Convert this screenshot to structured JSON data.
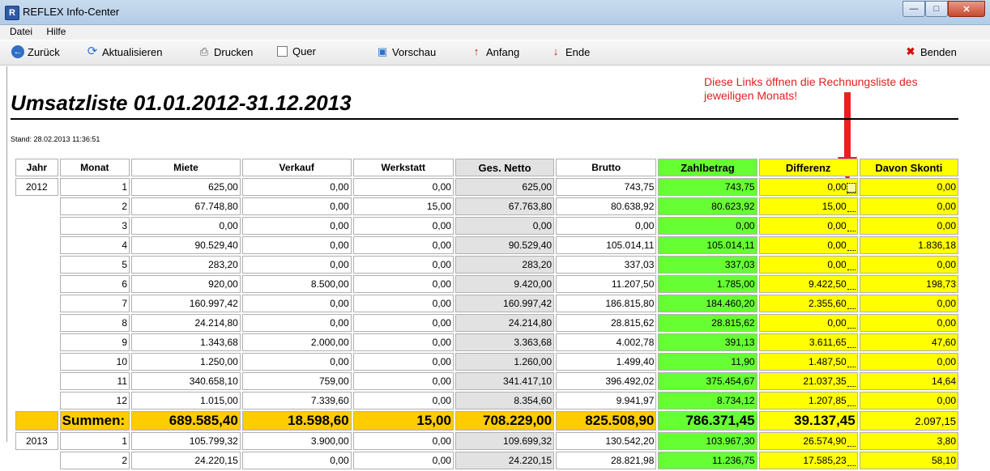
{
  "window": {
    "title": "REFLEX Info-Center"
  },
  "menu": [
    "Datei",
    "Hilfe"
  ],
  "toolbar": {
    "back": "Zurück",
    "refresh": "Aktualisieren",
    "print": "Drucken",
    "landscape": "Quer",
    "preview": "Vorschau",
    "start": "Anfang",
    "end": "Ende",
    "quit": "Benden"
  },
  "report": {
    "title": "Umsatzliste 01.01.2012-31.12.2013",
    "stand": "Stand: 28.02.2013 11:36:51",
    "annotation": "Diese Links öffnen die Rechnungsliste des jeweiligen Monats!"
  },
  "columns": [
    "Jahr",
    "Monat",
    "Miete",
    "Verkauf",
    "Werkstatt",
    "Ges. Netto",
    "Brutto",
    "Zahlbetrag",
    "Differenz",
    "Davon Skonti"
  ],
  "colors": {
    "netto": "#e2e2e2",
    "zahlbetrag": "#66ff33",
    "differenz": "#ffff00",
    "summen": "#ffcc00",
    "annotation": "#e02020"
  },
  "rows": [
    {
      "jahr": "2012",
      "monat": "1",
      "miete": "625,00",
      "verkauf": "0,00",
      "werkstatt": "0,00",
      "netto": "625,00",
      "brutto": "743,75",
      "zahl": "743,75",
      "diff": "0,00",
      "skonti": "0,00"
    },
    {
      "jahr": "",
      "monat": "2",
      "miete": "67.748,80",
      "verkauf": "0,00",
      "werkstatt": "15,00",
      "netto": "67.763,80",
      "brutto": "80.638,92",
      "zahl": "80.623,92",
      "diff": "15,00",
      "skonti": "0,00"
    },
    {
      "jahr": "",
      "monat": "3",
      "miete": "0,00",
      "verkauf": "0,00",
      "werkstatt": "0,00",
      "netto": "0,00",
      "brutto": "0,00",
      "zahl": "0,00",
      "diff": "0,00",
      "skonti": "0,00"
    },
    {
      "jahr": "",
      "monat": "4",
      "miete": "90.529,40",
      "verkauf": "0,00",
      "werkstatt": "0,00",
      "netto": "90.529,40",
      "brutto": "105.014,11",
      "zahl": "105.014,11",
      "diff": "0,00",
      "skonti": "1.836,18"
    },
    {
      "jahr": "",
      "monat": "5",
      "miete": "283,20",
      "verkauf": "0,00",
      "werkstatt": "0,00",
      "netto": "283,20",
      "brutto": "337,03",
      "zahl": "337,03",
      "diff": "0,00",
      "skonti": "0,00"
    },
    {
      "jahr": "",
      "monat": "6",
      "miete": "920,00",
      "verkauf": "8.500,00",
      "werkstatt": "0,00",
      "netto": "9.420,00",
      "brutto": "11.207,50",
      "zahl": "1.785,00",
      "diff": "9.422,50",
      "skonti": "198,73"
    },
    {
      "jahr": "",
      "monat": "7",
      "miete": "160.997,42",
      "verkauf": "0,00",
      "werkstatt": "0,00",
      "netto": "160.997,42",
      "brutto": "186.815,80",
      "zahl": "184.460,20",
      "diff": "2.355,60",
      "skonti": "0,00"
    },
    {
      "jahr": "",
      "monat": "8",
      "miete": "24.214,80",
      "verkauf": "0,00",
      "werkstatt": "0,00",
      "netto": "24.214,80",
      "brutto": "28.815,62",
      "zahl": "28.815,62",
      "diff": "0,00",
      "skonti": "0,00"
    },
    {
      "jahr": "",
      "monat": "9",
      "miete": "1.343,68",
      "verkauf": "2.000,00",
      "werkstatt": "0,00",
      "netto": "3.363,68",
      "brutto": "4.002,78",
      "zahl": "391,13",
      "diff": "3.611,65",
      "skonti": "47,60"
    },
    {
      "jahr": "",
      "monat": "10",
      "miete": "1.250,00",
      "verkauf": "0,00",
      "werkstatt": "0,00",
      "netto": "1.260,00",
      "brutto": "1.499,40",
      "zahl": "11,90",
      "diff": "1.487,50",
      "skonti": "0,00"
    },
    {
      "jahr": "",
      "monat": "11",
      "miete": "340.658,10",
      "verkauf": "759,00",
      "werkstatt": "0,00",
      "netto": "341.417,10",
      "brutto": "396.492,02",
      "zahl": "375.454,67",
      "diff": "21.037,35",
      "skonti": "14,64"
    },
    {
      "jahr": "",
      "monat": "12",
      "miete": "1.015,00",
      "verkauf": "7.339,60",
      "werkstatt": "0,00",
      "netto": "8.354,60",
      "brutto": "9.941,97",
      "zahl": "8.734,12",
      "diff": "1.207,85",
      "skonti": "0,00"
    }
  ],
  "summen": {
    "label": "Summen:",
    "miete": "689.585,40",
    "verkauf": "18.598,60",
    "werkstatt": "15,00",
    "netto": "708.229,00",
    "brutto": "825.508,90",
    "zahl": "786.371,45",
    "diff": "39.137,45",
    "skonti": "2.097,15"
  },
  "rows2013": [
    {
      "jahr": "2013",
      "monat": "1",
      "miete": "105.799,32",
      "verkauf": "3.900,00",
      "werkstatt": "0,00",
      "netto": "109.699,32",
      "brutto": "130.542,20",
      "zahl": "103.967,30",
      "diff": "26.574,90",
      "skonti": "3,80"
    },
    {
      "jahr": "",
      "monat": "2",
      "miete": "24.220,15",
      "verkauf": "0,00",
      "werkstatt": "0,00",
      "netto": "24.220,15",
      "brutto": "28.821,98",
      "zahl": "11.236,75",
      "diff": "17.585,23",
      "skonti": "58,10"
    }
  ]
}
